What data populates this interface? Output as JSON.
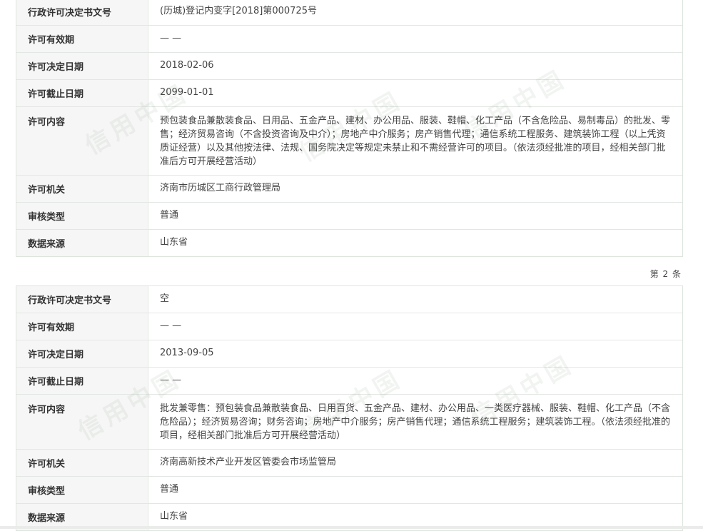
{
  "sections": [
    {
      "rows": [
        {
          "label": "行政许可决定书文号",
          "value": "(历城)登记内变字[2018]第000725号"
        },
        {
          "label": "许可有效期",
          "value": "— —"
        },
        {
          "label": "许可决定日期",
          "value": "2018-02-06"
        },
        {
          "label": "许可截止日期",
          "value": "2099-01-01"
        },
        {
          "label": "许可内容",
          "value": "预包装食品兼散装食品、日用品、五金产品、建材、办公用品、服装、鞋帽、化工产品（不含危险品、易制毒品）的批发、零售；经济贸易咨询（不含投资咨询及中介）；房地产中介服务；房产销售代理；通信系统工程服务、建筑装饰工程（以上凭资质证经营）以及其他按法律、法规、国务院决定等规定未禁止和不需经营许可的项目。（依法须经批准的项目，经相关部门批准后方可开展经营活动）"
        },
        {
          "label": "许可机关",
          "value": "济南市历城区工商行政管理局"
        },
        {
          "label": "审核类型",
          "value": "普通"
        },
        {
          "label": "数据来源",
          "value": "山东省"
        }
      ]
    },
    {
      "rows": [
        {
          "label": "行政许可决定书文号",
          "value": "空"
        },
        {
          "label": "许可有效期",
          "value": "— —"
        },
        {
          "label": "许可决定日期",
          "value": "2013-09-05"
        },
        {
          "label": "许可截止日期",
          "value": "— —"
        },
        {
          "label": "许可内容",
          "value": "批发兼零售：预包装食品兼散装食品、日用百货、五金产品、建材、办公用品、一类医疗器械、服装、鞋帽、化工产品（不含危险品）；经济贸易咨询；财务咨询；房地产中介服务；房产销售代理；通信系统工程服务；建筑装饰工程。（依法须经批准的项目，经相关部门批准后方可开展经营活动）"
        },
        {
          "label": "许可机关",
          "value": "济南高新技术产业开发区管委会市场监管局"
        },
        {
          "label": "审核类型",
          "value": "普通"
        },
        {
          "label": "数据来源",
          "value": "山东省"
        }
      ]
    }
  ],
  "page_note": "第 2 条",
  "watermark": "信用中国"
}
